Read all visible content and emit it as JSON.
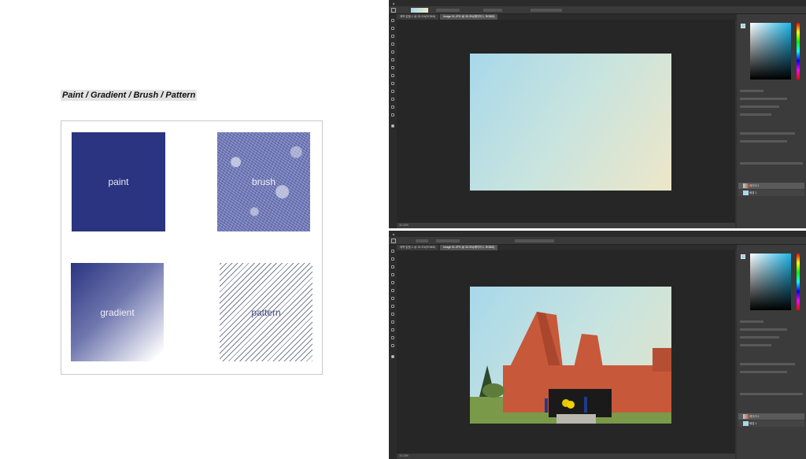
{
  "left": {
    "title": "Paint / Gradient / Brush / Pattern",
    "swatches": {
      "paint": "paint",
      "brush": "brush",
      "gradient": "gradient",
      "pattern": "pattern"
    }
  },
  "photoshop": {
    "top": {
      "share_label": "공유",
      "tabs": [
        "제목 없음-1 @ 33.3%(RGB/8)",
        "Image 01.JPG @ 33.3%(레이어 1, RGB/8)"
      ],
      "status": "33.33%",
      "layers": [
        "레이어 1",
        "배경 1"
      ]
    },
    "bottom": {
      "share_label": "공유",
      "tabs": [
        "제목 없음-1 @ 33.3%(RGB/8)",
        "Image 01.JPG @ 33.3%(레이어 1, RGB/8)"
      ],
      "status": "33.33%",
      "layers": [
        "레이어 1",
        "배경 1"
      ]
    }
  },
  "colors": {
    "navy": "#2a3480",
    "canvas_start": "#a8d8ea",
    "canvas_end": "#eee6c8",
    "brick": "#c8583a",
    "ps_bg": "#323232"
  }
}
